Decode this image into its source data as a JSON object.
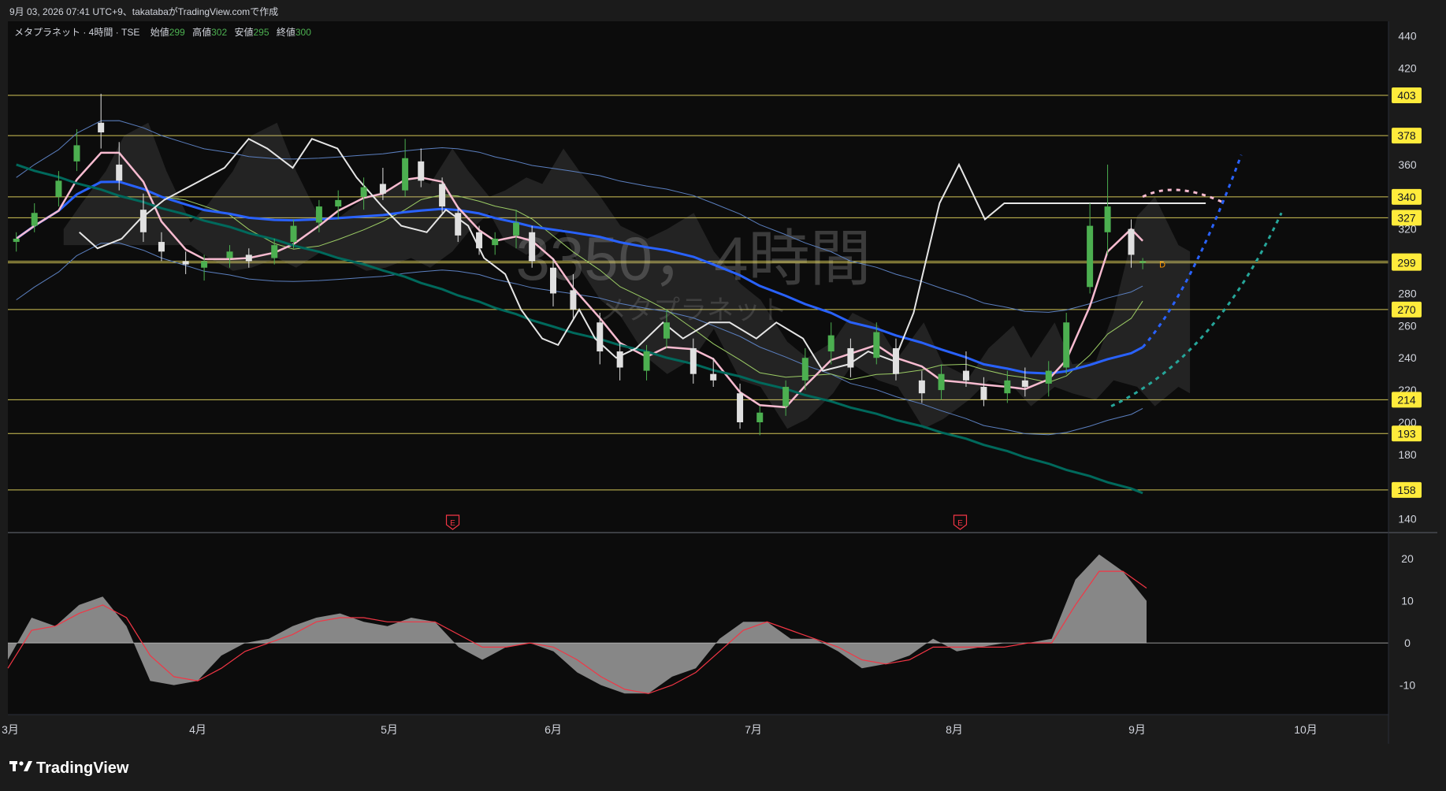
{
  "header": {
    "caption": "9月 03, 2026 07:41 UTC+9、takatabaがTradingView.comで作成"
  },
  "legend": {
    "symbol_text": "メタプラネット · 4時間 · TSE",
    "open_label": "始値",
    "open_value": "299",
    "high_label": "高値",
    "high_value": "302",
    "low_label": "安値",
    "low_value": "295",
    "close_label": "終値",
    "close_value": "300"
  },
  "watermark": {
    "ticker_line": "3350，4時間",
    "name_line": "メタプラネット"
  },
  "brand": {
    "name": "TradingView"
  },
  "event_marker_label": "E",
  "dividend_marker_label": "D",
  "colors": {
    "background": "#0c0c0c",
    "frame": "#1b1b1b",
    "bull": "#4caf50",
    "bear": "#e0e0e0",
    "level_line": "#f5e663",
    "level_tag": "#ffeb3b",
    "ma_fast": "#f8bbd0",
    "ma_slow": "#2962ff",
    "ma_long": "#00695c",
    "band": "#5b7fbf",
    "ichimoku_line": "#e6e6e6",
    "oscillator_fill": "#9e9e9e",
    "oscillator_signal": "#f23645",
    "event_marker": "#f23645",
    "dividend_marker": "#ff9800"
  },
  "chart_data": [
    {
      "type": "candlestick",
      "title": "",
      "ylim": [
        132,
        449
      ],
      "y_ticks": [
        140,
        160,
        180,
        200,
        220,
        240,
        260,
        280,
        300,
        320,
        340,
        360,
        380,
        400,
        420,
        440
      ],
      "y_tick_labels": [
        "140",
        "",
        "180",
        "200",
        "220",
        "240",
        "260",
        "280",
        "300",
        "320",
        "340",
        "360",
        "",
        "",
        "420",
        "440"
      ],
      "x_month_labels": [
        "3月",
        "4月",
        "5月",
        "6月",
        "7月",
        "8月",
        "9月",
        "10月"
      ],
      "horizontal_levels": [
        403,
        378,
        340,
        327,
        300,
        299,
        270,
        214,
        193,
        158
      ],
      "ohlc_points": [
        [
          "3/02",
          312,
          318,
          306,
          314
        ],
        [
          "3/05",
          322,
          336,
          318,
          330
        ],
        [
          "3/09",
          340,
          356,
          334,
          350
        ],
        [
          "3/12",
          362,
          382,
          356,
          372
        ],
        [
          "3/16",
          386,
          404,
          370,
          380
        ],
        [
          "3/19",
          360,
          374,
          344,
          350
        ],
        [
          "3/23",
          332,
          342,
          312,
          318
        ],
        [
          "3/26",
          312,
          318,
          300,
          306
        ],
        [
          "3/30",
          300,
          306,
          292,
          298
        ],
        [
          "4/02",
          296,
          304,
          288,
          300
        ],
        [
          "4/06",
          302,
          310,
          296,
          306
        ],
        [
          "4/09",
          304,
          308,
          296,
          300
        ],
        [
          "4/13",
          302,
          314,
          298,
          310
        ],
        [
          "4/16",
          312,
          326,
          308,
          322
        ],
        [
          "4/20",
          324,
          338,
          318,
          334
        ],
        [
          "4/23",
          334,
          344,
          326,
          338
        ],
        [
          "4/27",
          340,
          352,
          332,
          346
        ],
        [
          "4/30",
          348,
          358,
          338,
          342
        ],
        [
          "5/04",
          344,
          376,
          340,
          364
        ],
        [
          "5/07",
          362,
          370,
          346,
          350
        ],
        [
          "5/11",
          348,
          352,
          330,
          334
        ],
        [
          "5/14",
          330,
          334,
          312,
          316
        ],
        [
          "5/18",
          318,
          322,
          304,
          308
        ],
        [
          "5/21",
          310,
          318,
          304,
          314
        ],
        [
          "5/25",
          316,
          332,
          308,
          324
        ],
        [
          "5/28",
          318,
          322,
          296,
          300
        ],
        [
          "6/01",
          296,
          302,
          272,
          280
        ],
        [
          "6/04",
          282,
          292,
          264,
          270
        ],
        [
          "6/08",
          262,
          268,
          236,
          244
        ],
        [
          "6/11",
          244,
          250,
          226,
          234
        ],
        [
          "6/15",
          232,
          248,
          226,
          244
        ],
        [
          "6/18",
          252,
          270,
          246,
          262
        ],
        [
          "6/22",
          246,
          252,
          224,
          230
        ],
        [
          "6/25",
          230,
          240,
          222,
          226
        ],
        [
          "6/29",
          218,
          224,
          196,
          200
        ],
        [
          "7/02",
          200,
          210,
          192,
          206
        ],
        [
          "7/06",
          210,
          226,
          204,
          222
        ],
        [
          "7/09",
          226,
          246,
          220,
          240
        ],
        [
          "7/13",
          244,
          262,
          236,
          254
        ],
        [
          "7/16",
          246,
          252,
          228,
          234
        ],
        [
          "7/20",
          240,
          262,
          236,
          256
        ],
        [
          "7/23",
          246,
          252,
          226,
          230
        ],
        [
          "7/27",
          226,
          232,
          212,
          218
        ],
        [
          "7/30",
          220,
          236,
          214,
          230
        ],
        [
          "8/03",
          232,
          244,
          222,
          226
        ],
        [
          "8/06",
          222,
          228,
          210,
          214
        ],
        [
          "8/10",
          218,
          232,
          212,
          226
        ],
        [
          "8/13",
          226,
          234,
          216,
          222
        ],
        [
          "8/17",
          224,
          238,
          216,
          232
        ],
        [
          "8/20",
          234,
          268,
          230,
          262
        ],
        [
          "8/24",
          284,
          336,
          280,
          322
        ],
        [
          "8/27",
          318,
          360,
          304,
          334
        ],
        [
          "8/31",
          320,
          326,
          296,
          304
        ],
        [
          "9/02",
          299,
          302,
          295,
          300
        ]
      ]
    },
    {
      "type": "area",
      "title": "",
      "ylim": [
        -17,
        26
      ],
      "y_ticks": [
        20,
        10,
        0,
        -10
      ],
      "series": [
        {
          "values": [
            -4,
            6,
            4,
            9,
            11,
            4,
            -9,
            -10,
            -9,
            -3,
            0,
            1,
            4,
            6,
            7,
            5,
            4,
            6,
            5,
            -1,
            -4,
            -1,
            0,
            -2,
            -7,
            -10,
            -12,
            -12,
            -8,
            -6,
            1,
            5,
            5,
            1,
            1,
            -2,
            -6,
            -5,
            -3,
            1,
            -2,
            -1,
            0,
            0,
            1,
            15,
            21,
            17,
            10
          ]
        },
        {
          "values": [
            -6,
            3,
            4,
            7,
            9,
            6,
            -3,
            -8,
            -9,
            -6,
            -2,
            0,
            2,
            5,
            6,
            6,
            5,
            5,
            5,
            2,
            -1,
            -1,
            0,
            -1,
            -4,
            -8,
            -11,
            -12,
            -10,
            -7,
            -2,
            3,
            5,
            3,
            1,
            -1,
            -4,
            -5,
            -4,
            -1,
            -1,
            -1,
            -1,
            0,
            0,
            9,
            17,
            17,
            13
          ]
        }
      ]
    }
  ]
}
